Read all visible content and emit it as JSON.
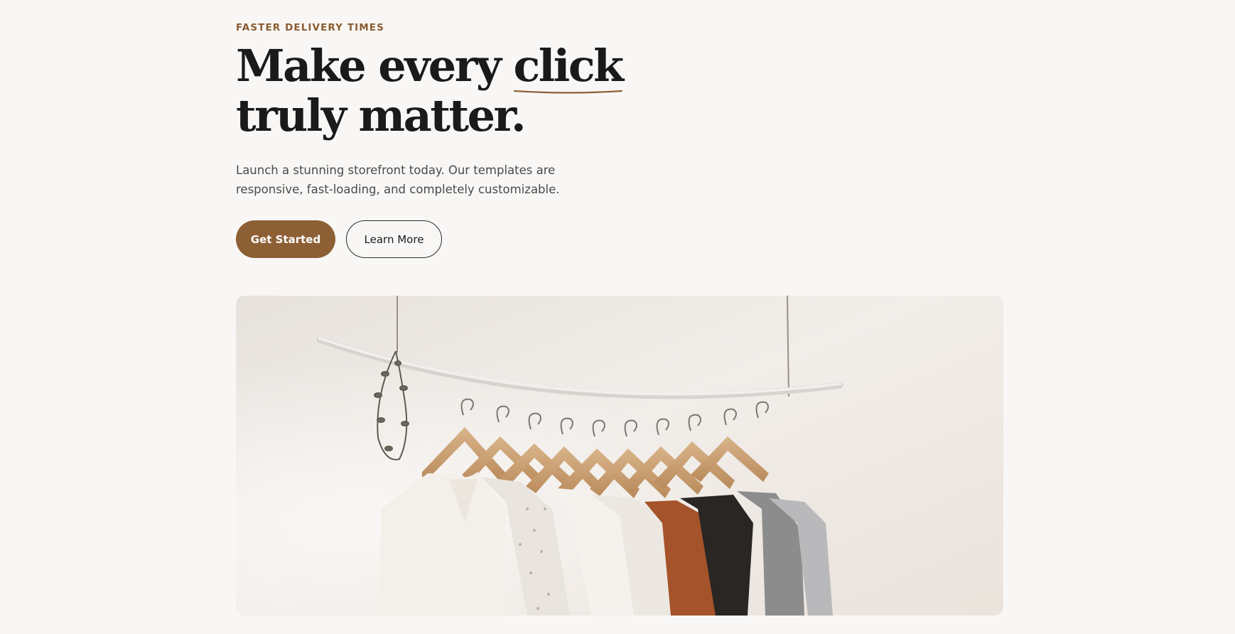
{
  "hero": {
    "eyebrow": "FASTER DELIVERY TIMES",
    "headline": {
      "part1": "Make every ",
      "highlight": "click",
      "part2": " truly matter."
    },
    "subtitle": "Launch a stunning storefront today. Our templates are responsive, fast-loading, and completely customizable.",
    "primary_button": "Get Started",
    "secondary_button": "Learn More",
    "image": {
      "icon": "clothing-rack-photo"
    }
  },
  "colors": {
    "accent": "#8d5f35",
    "eyebrow": "#8a5b30",
    "background": "#f9f7f5",
    "text": "#1a1a1a"
  }
}
